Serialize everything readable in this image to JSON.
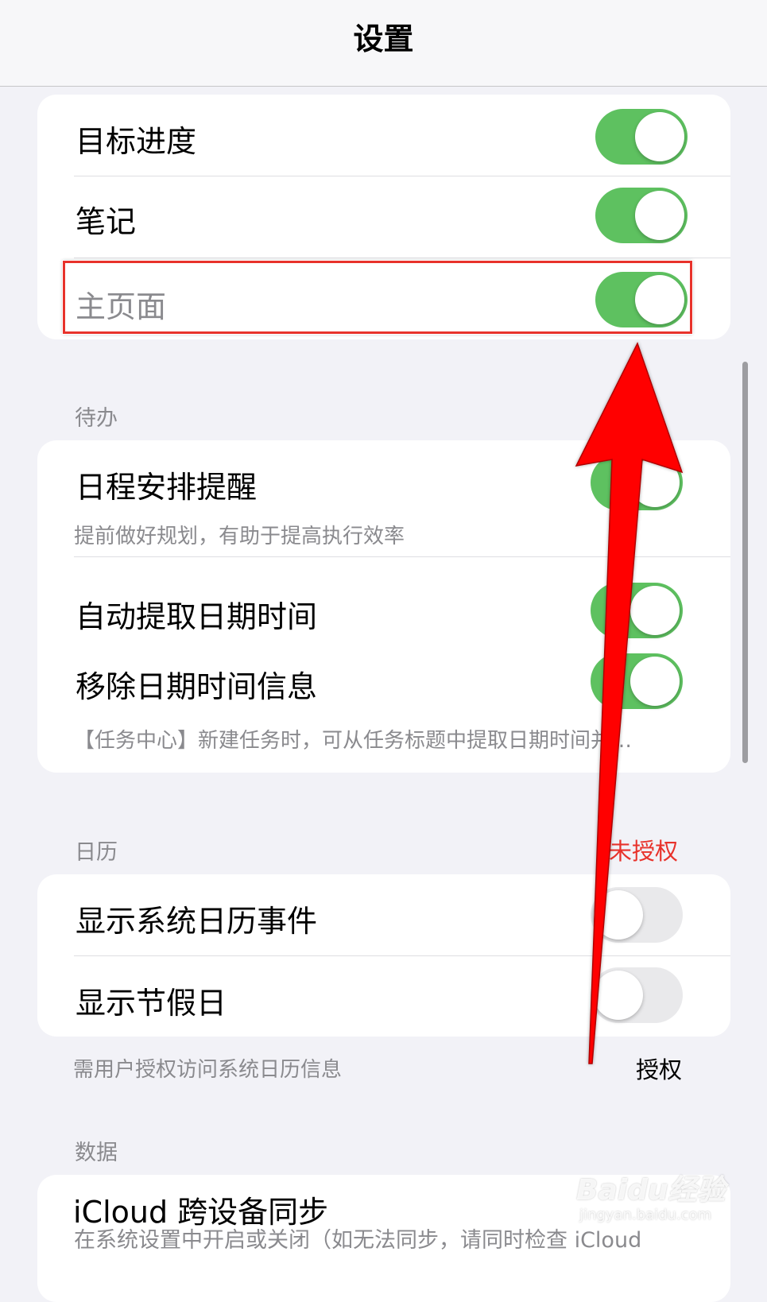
{
  "nav": {
    "title": "设置"
  },
  "card_general": {
    "rows": [
      {
        "label": "目标进度",
        "toggle": "on"
      },
      {
        "label": "笔记",
        "toggle": "on"
      },
      {
        "label": "主页面",
        "toggle": "on"
      }
    ]
  },
  "section_todo": {
    "header": "待办",
    "rows": [
      {
        "label": "日程安排提醒",
        "subtitle": "提前做好规划，有助于提高执行效率",
        "toggle": "on"
      },
      {
        "label": "自动提取日期时间",
        "toggle": "on"
      },
      {
        "label": "移除日期时间信息",
        "subtitle": "【任务中心】新建任务时，可从任务标题中提取日期时间并…",
        "toggle": "on"
      }
    ]
  },
  "section_calendar": {
    "header": "日历",
    "status": "未授权",
    "rows": [
      {
        "label": "显示系统日历事件",
        "toggle": "off"
      },
      {
        "label": "显示节假日",
        "toggle": "off"
      }
    ],
    "footer": "需用户授权访问系统日历信息",
    "footer_action": "授权"
  },
  "section_data": {
    "header": "数据",
    "rows": [
      {
        "label": "iCloud 跨设备同步",
        "subtitle": "在系统设置中开启或关闭（如无法同步，请同时检查 iCloud"
      }
    ]
  },
  "watermark": {
    "main": "Baidu经验",
    "sub": "jingyan.baidu.com"
  },
  "colors": {
    "toggle_on": "#5ec160",
    "toggle_off": "#e9e9eb",
    "highlight": "#e8322b",
    "status_red": "#e8322b",
    "arrow": "#ff0000"
  }
}
